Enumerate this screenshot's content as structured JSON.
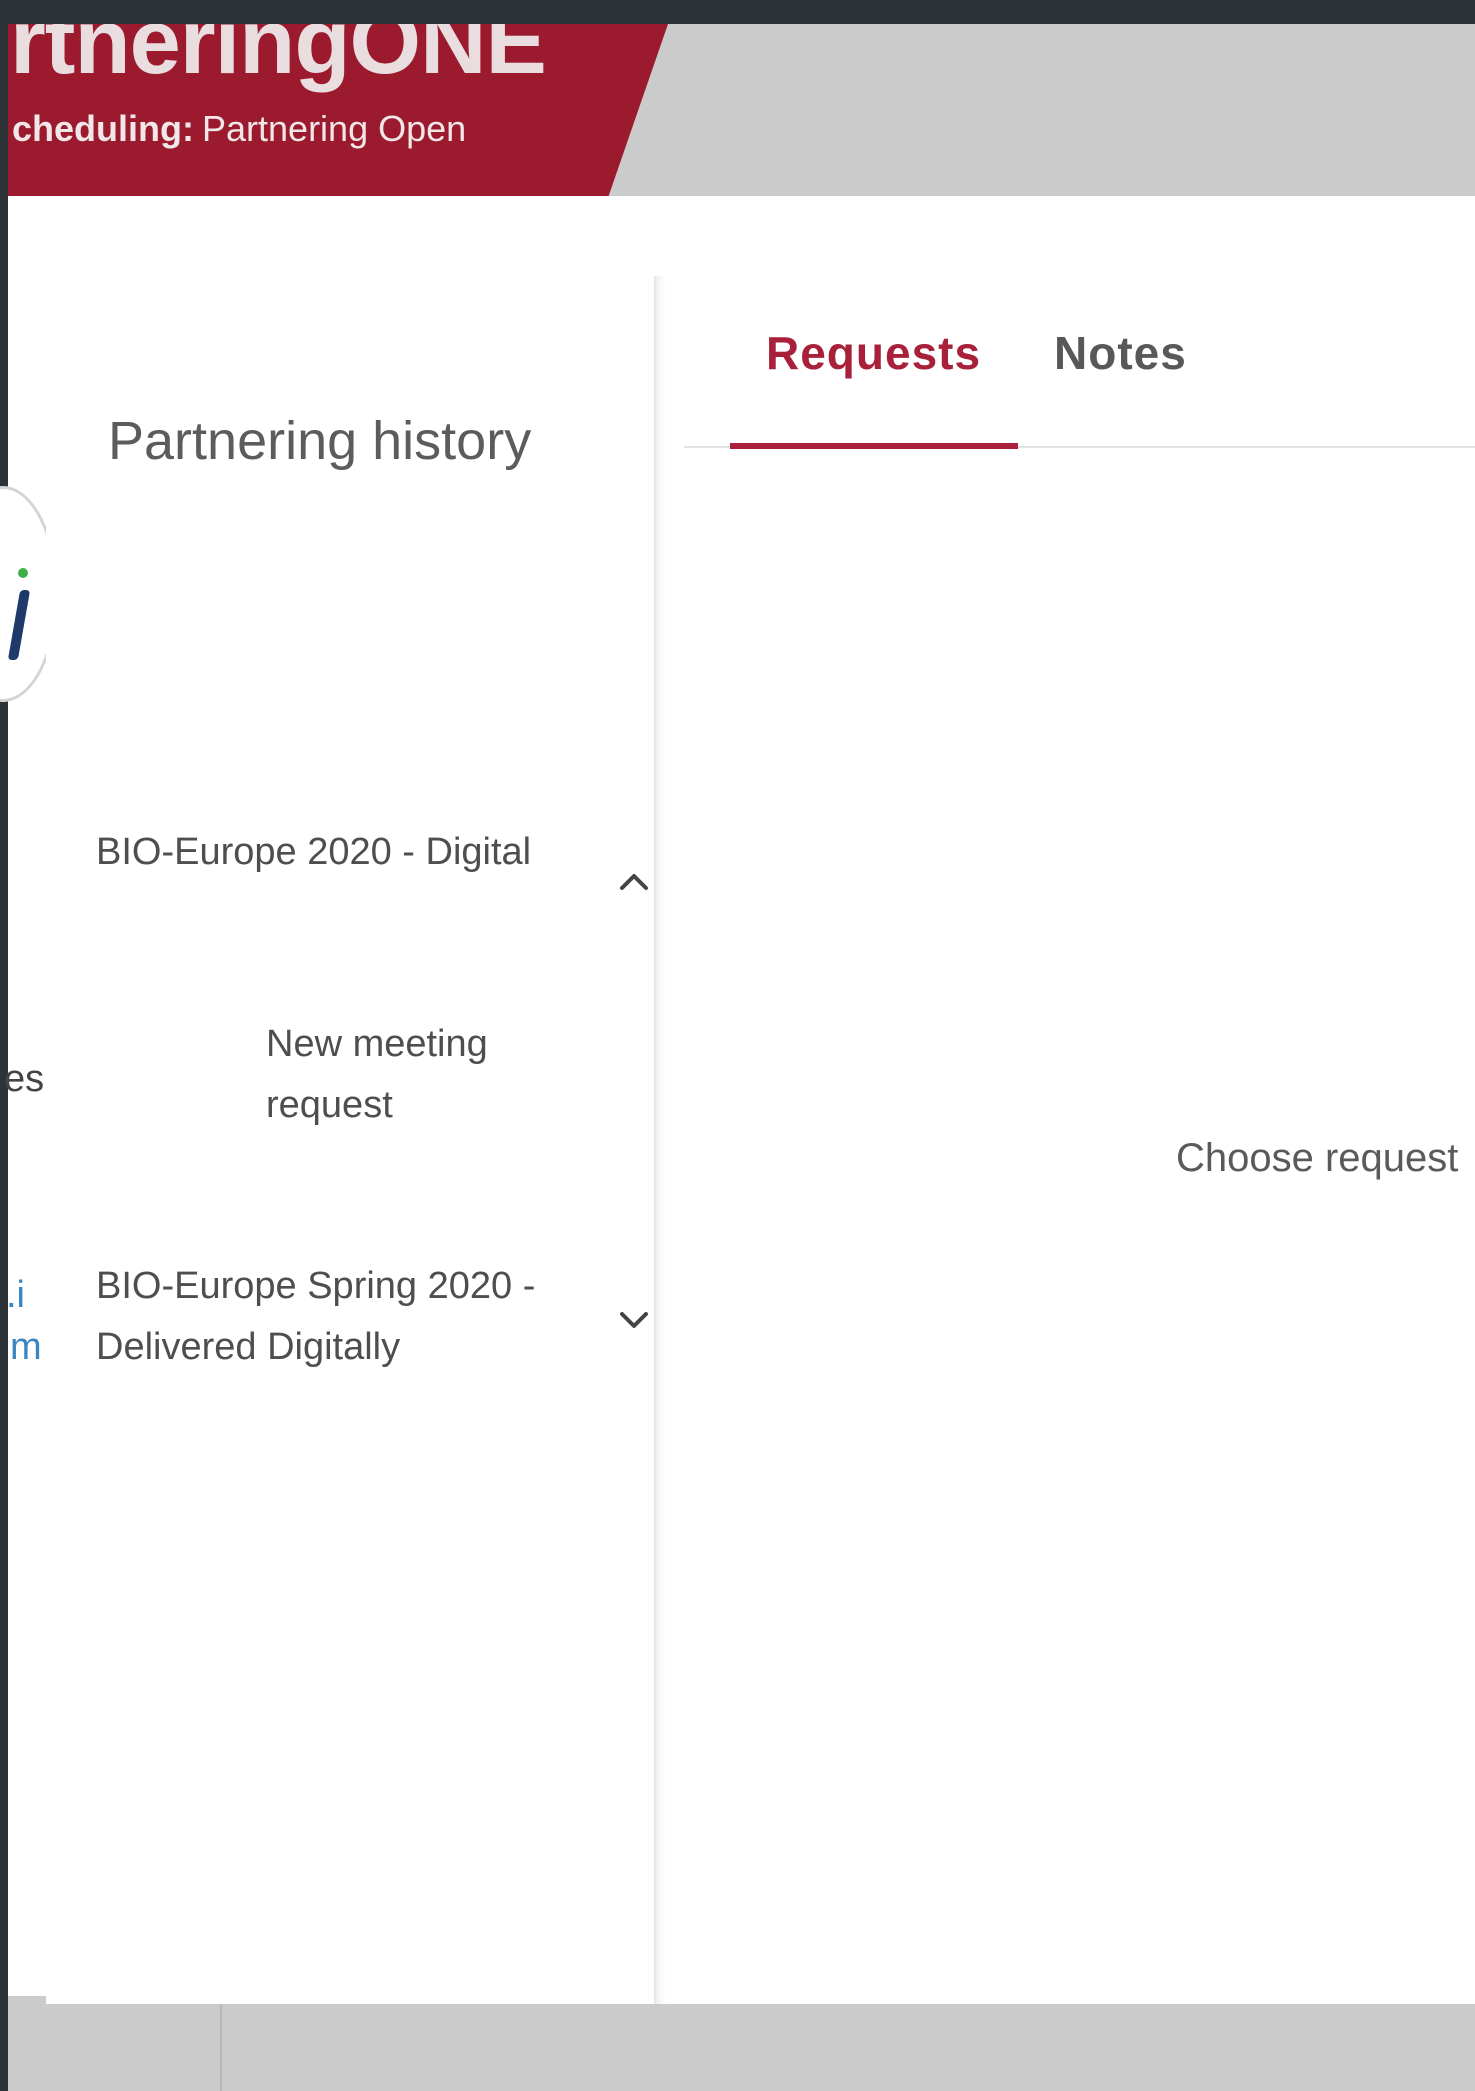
{
  "brand": {
    "logo_text": "rtneringONE",
    "subtitle_key": "cheduling:",
    "subtitle_value": "Partnering Open",
    "color": "#9b1a2e"
  },
  "background_page": {
    "text_fragment": "es,",
    "link_fragment_1": ".i",
    "link_fragment_2": "m"
  },
  "history_panel": {
    "title": "Partnering history",
    "events": [
      {
        "label": "BIO-Europe 2020 - Digital",
        "expanded": true,
        "icon": "chevron-up-icon"
      },
      {
        "label": "BIO-Europe Spring 2020 - Delivered Digitally",
        "expanded": false,
        "icon": "chevron-down-icon"
      }
    ],
    "sub_items": [
      {
        "label": "New meeting request"
      }
    ]
  },
  "main_pane": {
    "tabs": [
      {
        "label": "Requests",
        "active": true
      },
      {
        "label": "Notes",
        "active": false
      }
    ],
    "empty_state_text": "Choose request",
    "accent_color": "#a8203a"
  }
}
